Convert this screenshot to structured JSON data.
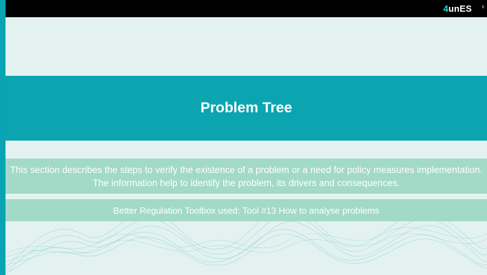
{
  "header": {
    "logo_mark": "4",
    "logo_text": "unES",
    "page_number": "6"
  },
  "slide": {
    "title": "Problem Tree",
    "description": "This section describes the steps to verify the existence of a problem or a need for policy measures implementation. The information help to identify the problem, its drivers and consequences.",
    "toolbox": "Better Regulation Toolbox used: Tool #13 How to analyse problems"
  },
  "colors": {
    "title_band": "#0aa5b1",
    "info_band": "#a2d9c7",
    "background": "#e3f2f0",
    "frame": "#08a4b4",
    "topbar": "#000000"
  }
}
